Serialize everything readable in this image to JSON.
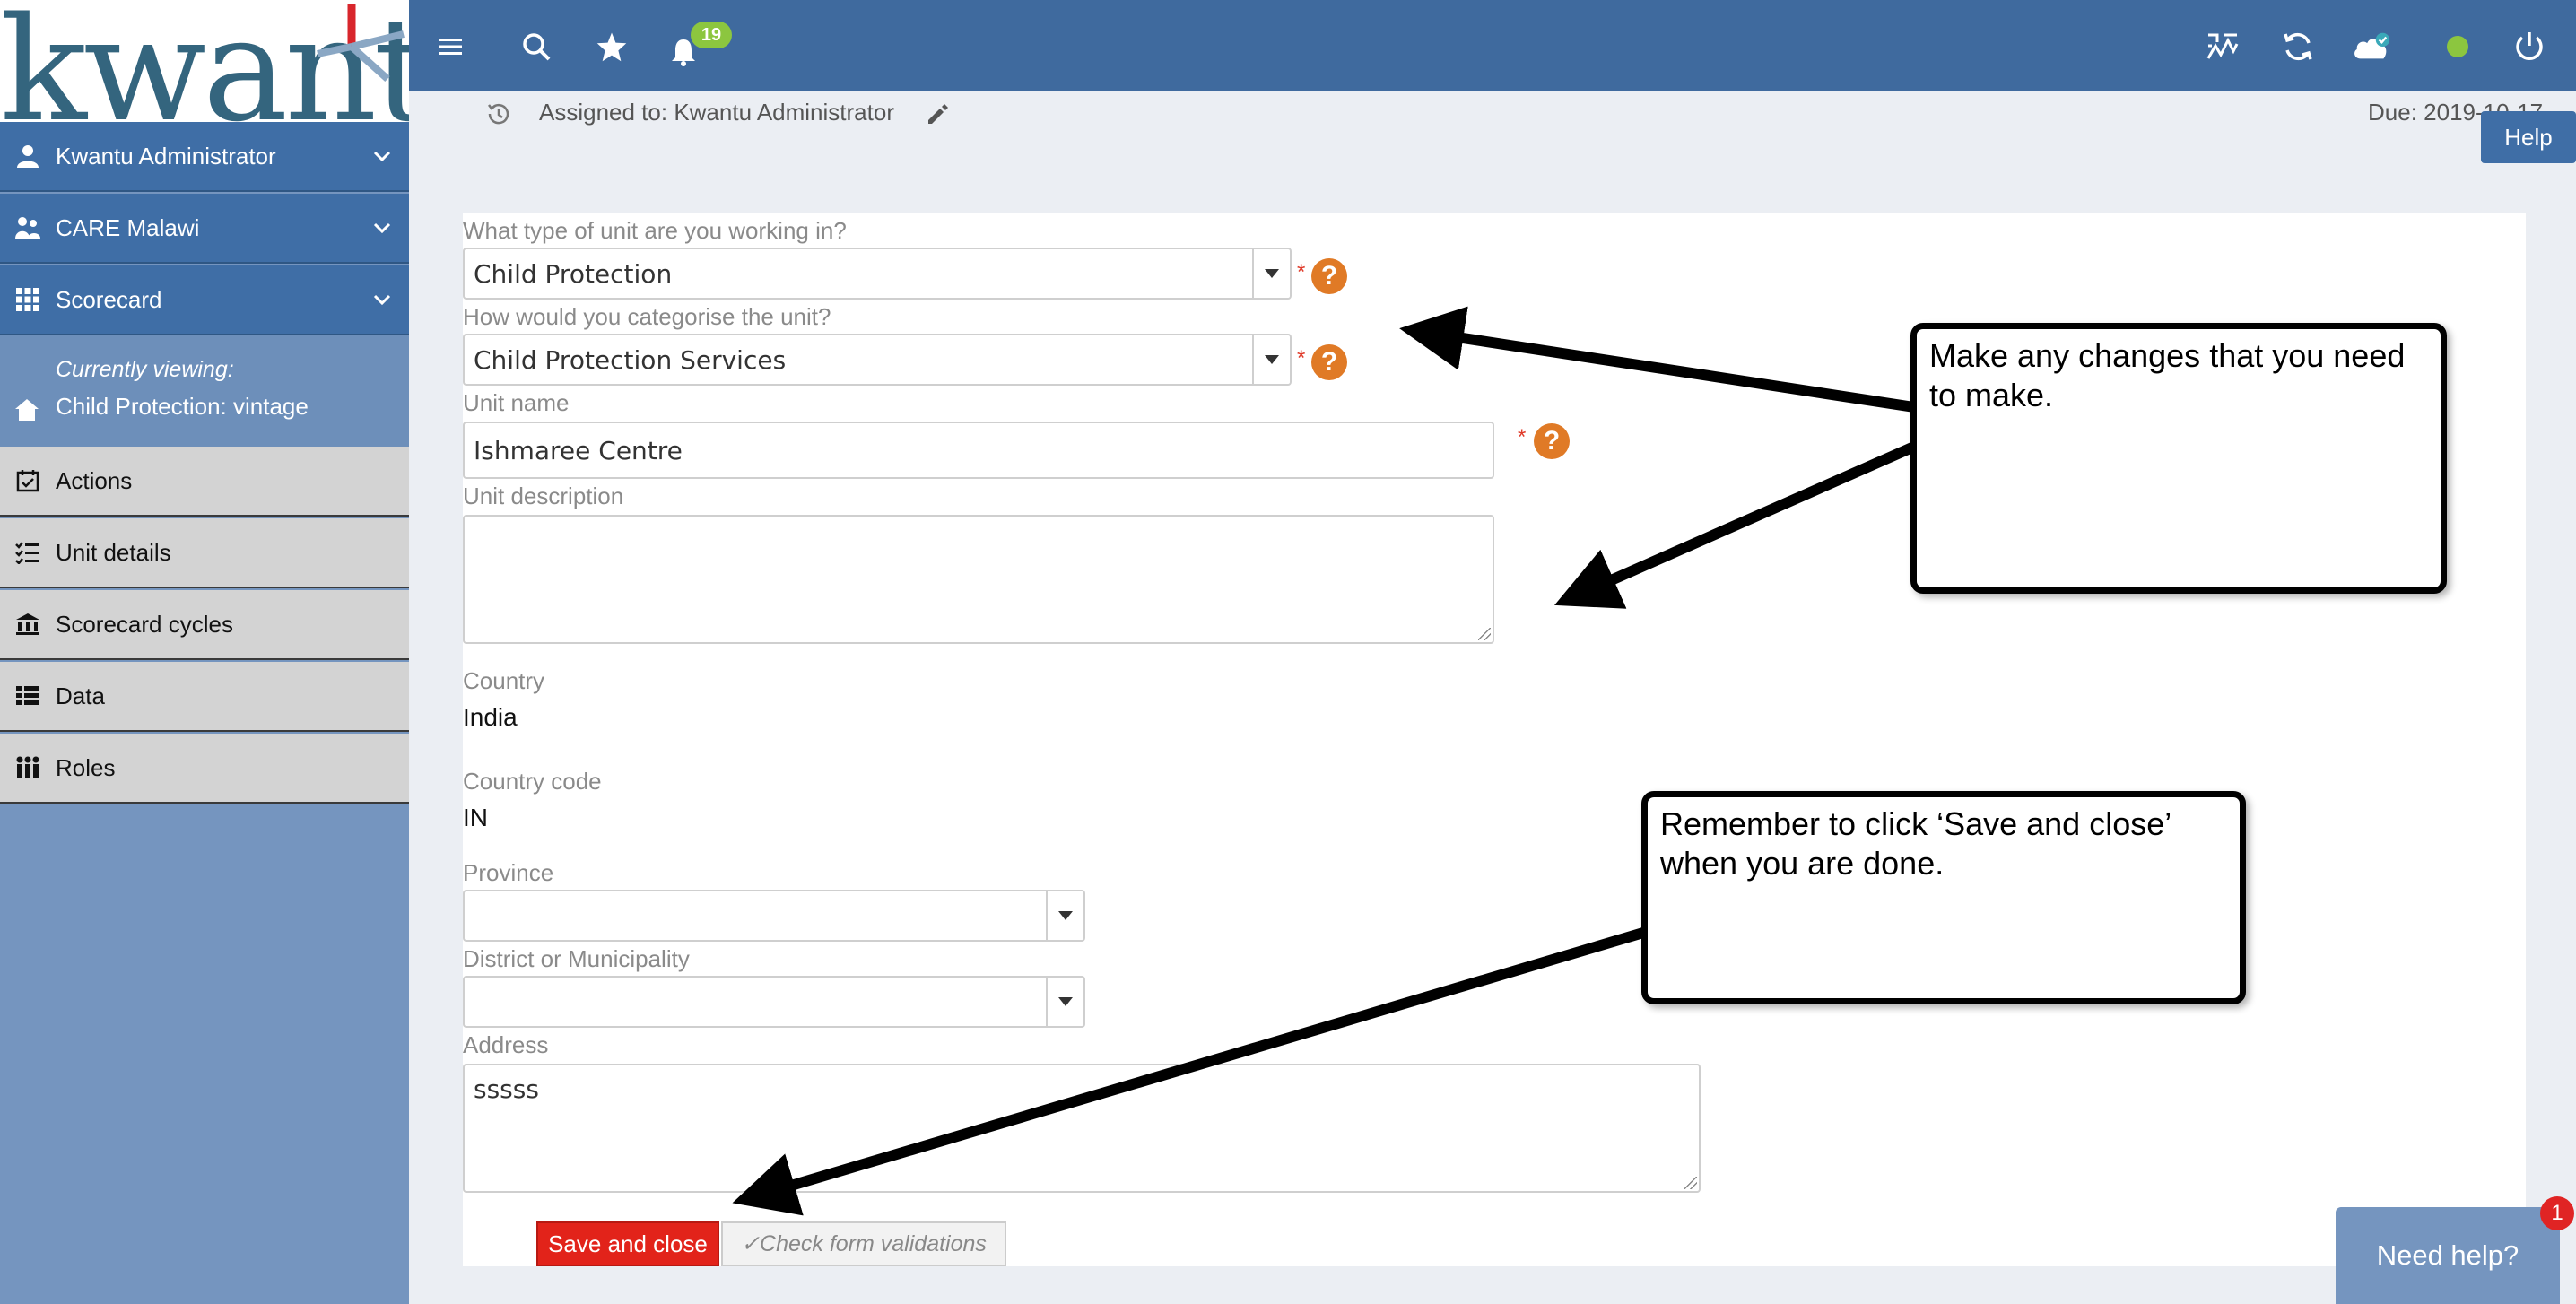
{
  "logo": {
    "text": "kwantu"
  },
  "sidebar": {
    "user": "Kwantu Administrator",
    "org": "CARE Malawi",
    "app": "Scorecard",
    "viewing_title": "Currently viewing:",
    "viewing_name": "Child Protection: vintage",
    "items": [
      {
        "label": "Actions",
        "icon": "calendar-check-icon"
      },
      {
        "label": "Unit details",
        "icon": "list-check-icon"
      },
      {
        "label": "Scorecard cycles",
        "icon": "building-icon"
      },
      {
        "label": "Data",
        "icon": "list-icon"
      },
      {
        "label": "Roles",
        "icon": "people-icon"
      }
    ]
  },
  "topbar": {
    "notifications_count": "19",
    "icons": [
      "menu-icon",
      "search-icon",
      "star-icon",
      "bell-icon",
      "dashboard-icon",
      "sync-icon",
      "cloud-check-icon",
      "status-online-icon",
      "power-icon"
    ],
    "accent": "#3f6a9e",
    "status_color": "#8cc63f"
  },
  "header": {
    "assigned": "Assigned to: Kwantu Administrator",
    "due": "Due: 2019-10-17",
    "help": "Help"
  },
  "form": {
    "unit_type": {
      "label": "What type of unit are you working in?",
      "value": "Child Protection"
    },
    "unit_category": {
      "label": "How would you categorise the unit?",
      "value": "Child Protection Services"
    },
    "unit_name": {
      "label": "Unit name",
      "value": "Ishmaree Centre"
    },
    "unit_description": {
      "label": "Unit description",
      "value": ""
    },
    "country": {
      "label": "Country",
      "value": "India"
    },
    "country_code": {
      "label": "Country code",
      "value": "IN"
    },
    "province": {
      "label": "Province",
      "value": ""
    },
    "district": {
      "label": "District or Municipality",
      "value": ""
    },
    "address": {
      "label": "Address",
      "value": "sssss"
    },
    "required_mark": "*",
    "help_mark": "?",
    "save": "Save and close",
    "check": "✓Check form validations"
  },
  "callouts": {
    "changes": "Make any changes that you need to make.",
    "save": "Remember to click ‘Save and close’ when you are done."
  },
  "need_help": {
    "label": "Need help?",
    "count": "1"
  }
}
